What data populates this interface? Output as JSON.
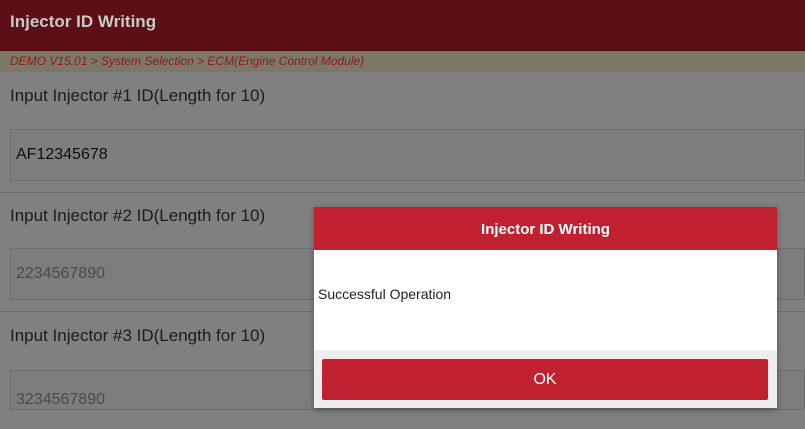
{
  "header": {
    "title": "Injector ID Writing",
    "breadcrumb": "DEMO V15.01 > System Selection > ECM(Engine Control Module)"
  },
  "fields": [
    {
      "label": "Input Injector #1 ID(Length for 10)",
      "value": "AF12345678"
    },
    {
      "label": "Input Injector #2 ID(Length for 10)",
      "value": "2234567890"
    },
    {
      "label": "Input Injector #3 ID(Length for 10)",
      "value": "3234567890"
    }
  ],
  "dialog": {
    "title": "Injector ID Writing",
    "message": "Successful Operation",
    "ok_label": "OK"
  },
  "colors": {
    "header_bg": "#5c0f14",
    "accent": "#c0202f",
    "breadcrumb_text": "#8a1c1c"
  }
}
